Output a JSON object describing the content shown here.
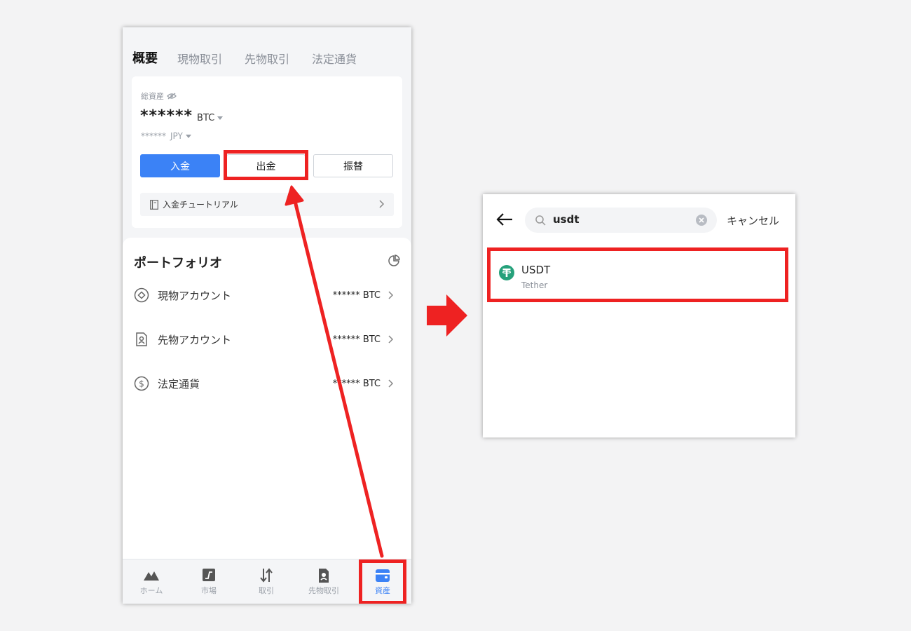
{
  "assets_screen": {
    "tabs": [
      {
        "label": "概要",
        "active": true
      },
      {
        "label": "現物取引",
        "active": false
      },
      {
        "label": "先物取引",
        "active": false
      },
      {
        "label": "法定通貨",
        "active": false
      }
    ],
    "total_assets_label": "総資産",
    "total_value_masked": "******",
    "total_unit": "BTC",
    "sub_value_masked": "******",
    "sub_unit": "JPY",
    "buttons": {
      "deposit": "入金",
      "withdraw": "出金",
      "transfer": "振替"
    },
    "tutorial_label": "入金チュートリアル",
    "portfolio_title": "ポートフォリオ",
    "accounts": [
      {
        "name": "現物アカウント",
        "value": "****** BTC"
      },
      {
        "name": "先物アカウント",
        "value": "****** BTC"
      },
      {
        "name": "法定通貨",
        "value": "****** BTC"
      }
    ],
    "bottom_nav": [
      {
        "label": "ホーム",
        "icon": "home-icon"
      },
      {
        "label": "市場",
        "icon": "market-icon"
      },
      {
        "label": "取引",
        "icon": "trade-icon"
      },
      {
        "label": "先物取引",
        "icon": "futures-icon"
      },
      {
        "label": "資産",
        "icon": "wallet-icon",
        "active": true
      }
    ],
    "colors": {
      "accent": "#3b82f6",
      "highlight": "#ee2222"
    }
  },
  "search_screen": {
    "query": "usdt",
    "cancel_label": "キャンセル",
    "result": {
      "symbol": "USDT",
      "name": "Tether",
      "icon_color": "#26a17b"
    }
  }
}
